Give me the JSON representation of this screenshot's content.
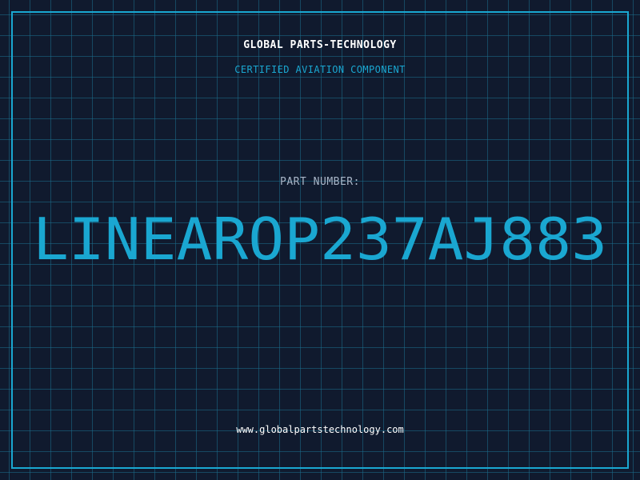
{
  "header": {
    "company": "GLOBAL PARTS-TECHNOLOGY",
    "subtitle": "CERTIFIED AVIATION COMPONENT"
  },
  "part": {
    "label": "PART NUMBER:",
    "number": "LINEAROP237AJ883"
  },
  "footer": {
    "website": "www.globalpartstechnology.com"
  },
  "colors": {
    "background": "#101a2e",
    "grid": "#1c6e8c",
    "accent": "#1aa7d1",
    "text": "#ffffff",
    "label": "#a9b6c8"
  }
}
